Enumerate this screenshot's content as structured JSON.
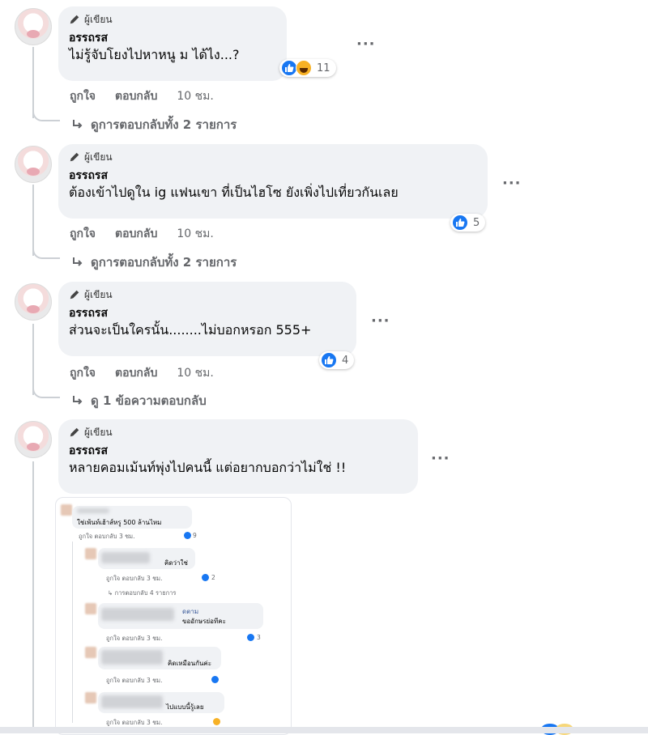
{
  "comments": [
    {
      "badge": "ผู้เขียน",
      "author": "อรรถรส",
      "text": "ไม่รู้จับโยงไปหาหนู ม ได้ไง...?",
      "reaction_count": "11",
      "reactions": [
        "like-icon",
        "haha-icon"
      ],
      "like_label": "ถูกใจ",
      "reply_label": "ตอบกลับ",
      "time": "10 ชม.",
      "view_replies": "ดูการตอบกลับทั้ง 2 รายการ"
    },
    {
      "badge": "ผู้เขียน",
      "author": "อรรถรส",
      "text": "ต้องเข้าไปดูใน ig แฟนเขา ที่เป็นไฮโซ ยังเพิ่งไปเที่ยวกันเลย",
      "reaction_count": "5",
      "reactions": [
        "like-icon"
      ],
      "like_label": "ถูกใจ",
      "reply_label": "ตอบกลับ",
      "time": "10 ชม.",
      "view_replies": "ดูการตอบกลับทั้ง 2 รายการ"
    },
    {
      "badge": "ผู้เขียน",
      "author": "อรรถรส",
      "text": "ส่วนจะเป็นใครนั้น........ไม่บอกหรอก 555+",
      "reaction_count": "4",
      "reactions": [
        "like-icon"
      ],
      "like_label": "ถูกใจ",
      "reply_label": "ตอบกลับ",
      "time": "10 ชม.",
      "view_replies": "ดู 1 ข้อความตอบกลับ"
    },
    {
      "badge": "ผู้เขียน",
      "author": "อรรถรส",
      "text": "หลายคอมเม้นท์พุ่งไปคนนี้ แต่อยากบอกว่าไม่ใช่ !!"
    }
  ],
  "embedded_screenshot": {
    "top_comment": "ใช่เพ้นท์เฮ้าส์หรู 500 ล้านไหม",
    "top_actions": "ถูกใจ   ตอบกลับ   3 ชม.",
    "top_count": "9",
    "replies": [
      {
        "text": "คิดว่าใช่",
        "actions": "ถูกใจ   ตอบกลับ   3 ชม.",
        "count": "2",
        "more": "การตอบกลับ 4 รายการ"
      },
      {
        "tag": "ดตาม",
        "text": "ขออักษรย่อทีคะ",
        "actions": "ถูกใจ   ตอบกลับ   3 ชม.",
        "count": "3"
      },
      {
        "text": "คิดเหมือนกันค่ะ",
        "actions": "ถูกใจ   ตอบกลับ   3 ชม.",
        "count": ""
      },
      {
        "text": "ไปแบบนี้รู้เลย",
        "actions": "ถูกใจ   ตอบกลับ   3 ชม.",
        "count": ""
      }
    ]
  },
  "colors": {
    "bubble": "#f0f2f5",
    "like_blue": "#1877f2",
    "meta_gray": "#65676b",
    "thread_line": "#ccd0d5"
  },
  "icons": {
    "author_badge": "pencil-icon",
    "reply_arrow": "reply-arrow-icon",
    "more": "more-options-icon"
  }
}
